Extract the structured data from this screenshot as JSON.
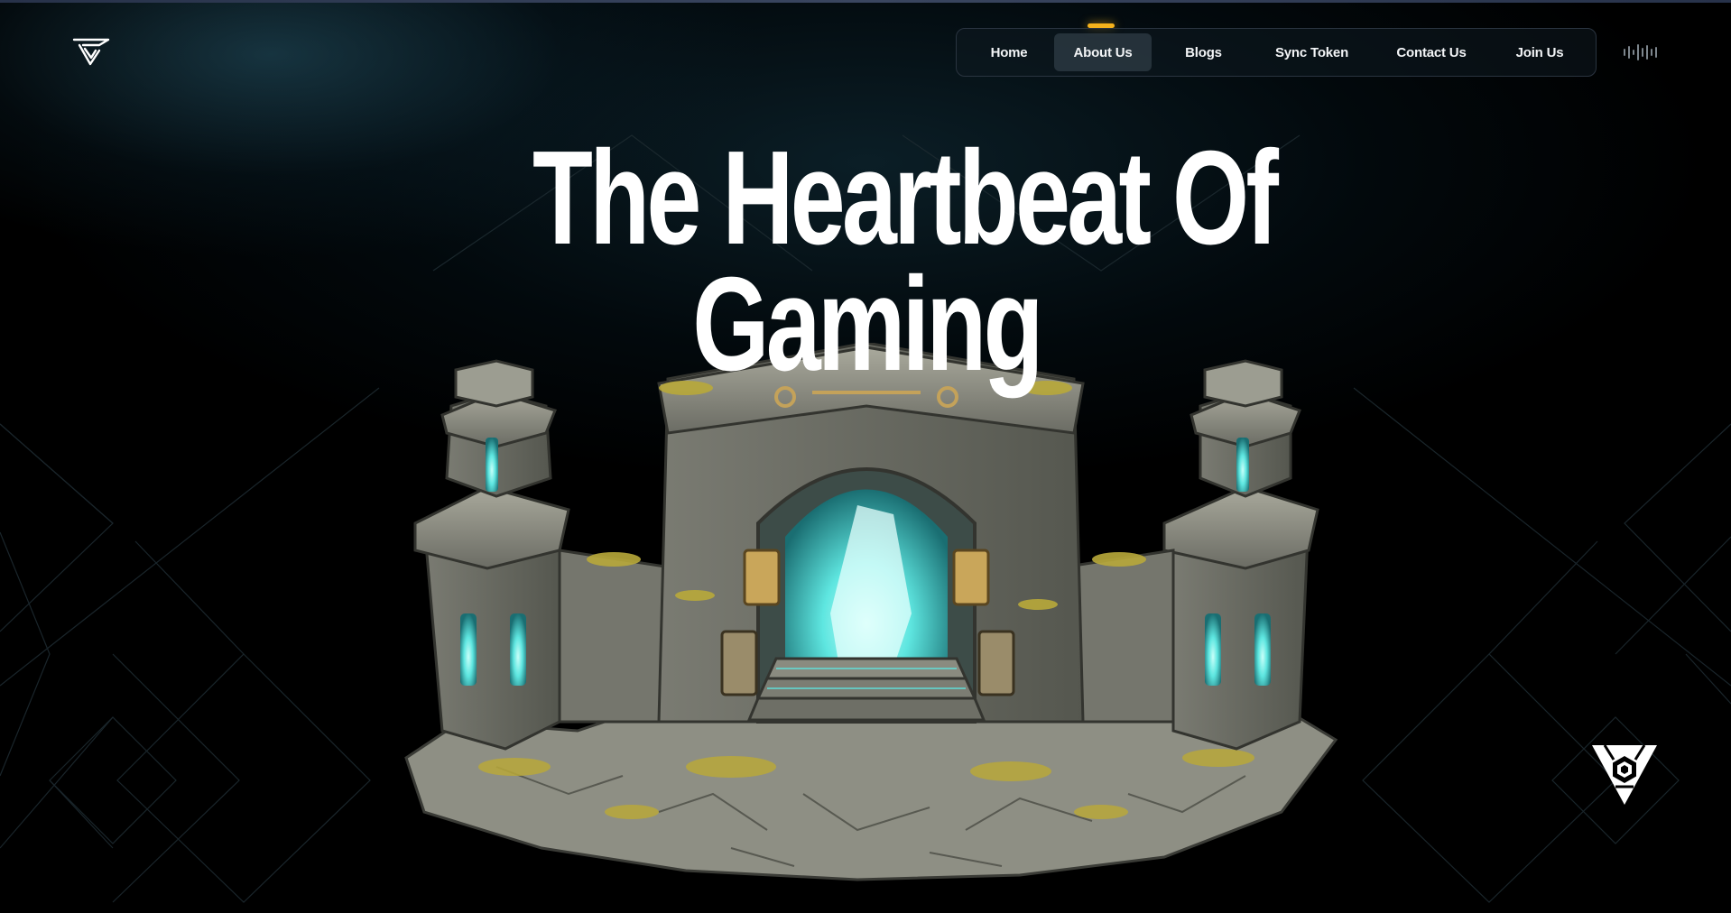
{
  "app": {
    "logo_icon": "stylized-v-logo-icon"
  },
  "nav": {
    "items": [
      {
        "label": "Home",
        "active": false
      },
      {
        "label": "About Us",
        "active": true
      },
      {
        "label": "Blogs",
        "active": false
      },
      {
        "label": "Sync Token",
        "active": false
      },
      {
        "label": "Contact Us",
        "active": false
      },
      {
        "label": "Join Us",
        "active": false
      }
    ],
    "active_indicator_color": "#f5b21c",
    "sound_icon": "sound-wave-icon"
  },
  "hero": {
    "title_line1": "The Heartbeat Of",
    "title_line2": "Gaming",
    "illustration": "stone-temple-portal-illustration"
  },
  "floating_badge": {
    "icon": "triangle-hexagon-emblem-icon"
  },
  "colors": {
    "background": "#000000",
    "glow": "#1e4658",
    "accent": "#f5b21c",
    "portal_glow": "#5ee6e0",
    "stone": "#8f9087",
    "moss": "#b8a83a"
  }
}
